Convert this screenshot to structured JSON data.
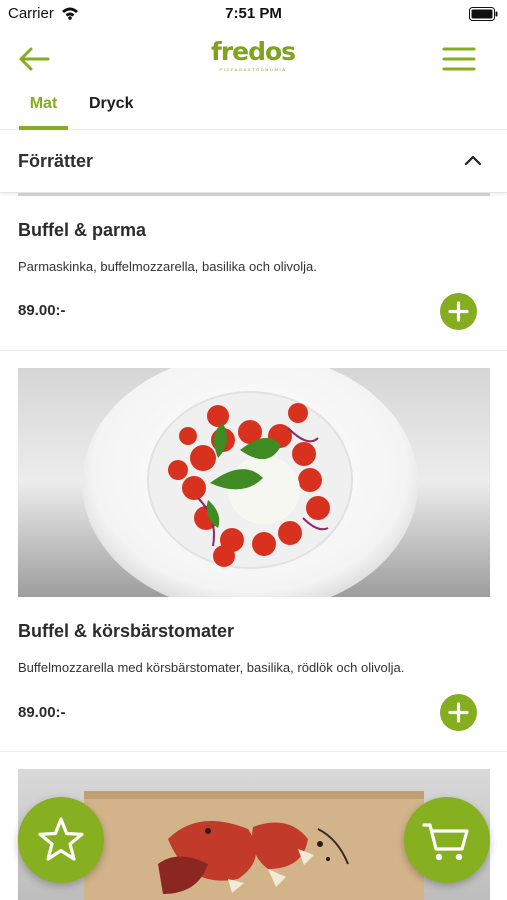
{
  "status_bar": {
    "carrier": "Carrier",
    "time": "7:51 PM",
    "wifi_icon": "wifi-icon",
    "battery_icon": "battery-icon"
  },
  "nav": {
    "back_icon": "arrow-left-icon",
    "logo_text": "fredos",
    "logo_subtitle": "PIZZAGASTRONOMIA",
    "menu_icon": "hamburger-menu-icon"
  },
  "tabs": [
    {
      "label": "Mat",
      "selected": true
    },
    {
      "label": "Dryck",
      "selected": false
    }
  ],
  "section": {
    "title": "Förrätter",
    "expanded": true,
    "toggle_icon": "chevron-up-icon"
  },
  "items": [
    {
      "title": "Buffel & parma",
      "description": "Parmaskinka, buffelmozzarella, basilika och olivolja.",
      "price": "89.00:-",
      "add_icon": "plus-icon"
    },
    {
      "title": "Buffel & körsbärstomater",
      "description": "Buffelmozzarella med körsbärstomater, basilika, rödlök och olivolja.",
      "price": "89.00:-",
      "add_icon": "plus-icon",
      "image": "buffalo-mozzarella-cherry-tomato-dish"
    },
    {
      "image": "cured-meat-board"
    }
  ],
  "fabs": {
    "favorites_icon": "star-icon",
    "cart_icon": "shopping-cart-icon"
  },
  "colors": {
    "accent": "#84ad1f",
    "text": "#2c2c2c",
    "divider": "#ececec"
  }
}
